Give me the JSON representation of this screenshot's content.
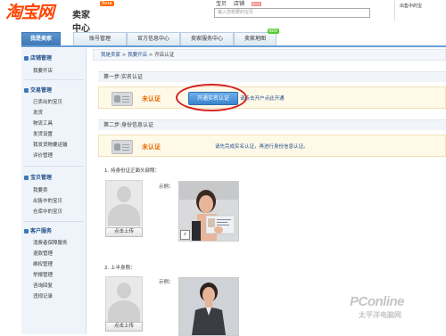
{
  "header": {
    "logo_text": "淘宝网",
    "logo_sub": "卖家中心",
    "logo_badge": "Beta",
    "search_tabs": [
      "宝贝",
      "店铺",
      "Beta"
    ],
    "search_placeholder": "输入您想要的宝贝",
    "right_link": "出售中的宝"
  },
  "nav": {
    "tabs": [
      {
        "label": "我是卖家"
      },
      {
        "label": "账号管理"
      },
      {
        "label": "官方信息中心"
      },
      {
        "label": "卖家服务中心"
      },
      {
        "label": "卖家地图",
        "badge": "NEW"
      }
    ]
  },
  "sidebar": {
    "sections": [
      {
        "title": "店铺管理",
        "items": [
          "我要开店"
        ]
      },
      {
        "title": "交易管理",
        "items": [
          "已卖出的宝贝",
          "发货",
          "物流工具",
          "发货设置",
          "我发货物要运输",
          "评价管理"
        ]
      },
      {
        "title": "宝贝管理",
        "items": [
          "我要卖",
          "出售中的宝贝",
          "仓库中的宝贝"
        ]
      },
      {
        "title": "客户服务",
        "items": [
          "消费者保障服务",
          "退款管理",
          "维权管理",
          "举报管理",
          "咨询回复",
          "违规记录"
        ]
      }
    ]
  },
  "breadcrumb": {
    "items": [
      "我是卖家",
      "我要开店",
      "开店认证"
    ],
    "sep": " > "
  },
  "step1": {
    "title": "第一步:实名认证",
    "status": "未认证",
    "button": "开通实名认证",
    "hint": "请点击开户点此开通"
  },
  "step2": {
    "title": "第二步:身份信息认证",
    "status": "未认证",
    "hint": "请先完成实名认证，再进行身份信息认证。"
  },
  "uploads": [
    {
      "label": "1. 持身份证正面头部照：",
      "button": "点击上传",
      "example_label": "示例："
    },
    {
      "label": "2. 上半身照：",
      "button": "点击上传",
      "example_label": "示例："
    }
  ],
  "watermark": {
    "main": "PConline",
    "sub": "太平洋电脑网"
  }
}
